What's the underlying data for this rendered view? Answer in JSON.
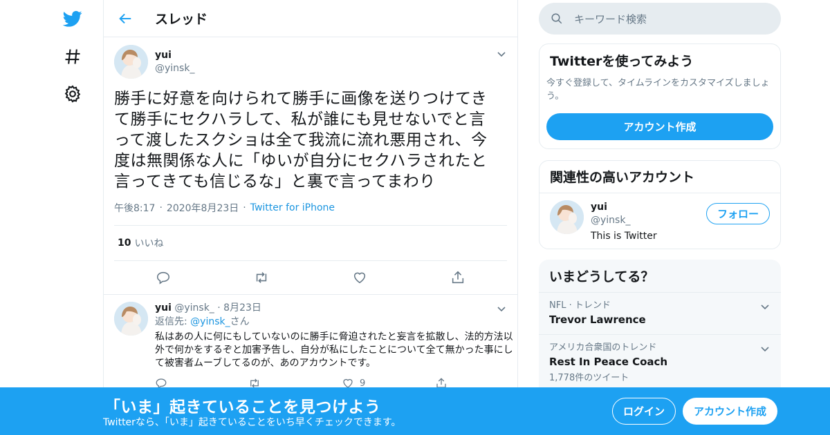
{
  "colors": {
    "accent": "#1da1f2",
    "muted": "#657786",
    "border": "#e6ecf0"
  },
  "nav": {
    "icons": [
      "twitter-logo-icon",
      "hashtag-icon",
      "gear-icon"
    ]
  },
  "header": {
    "title": "スレッド"
  },
  "tweet": {
    "name": "yui",
    "handle": "@yinsk_",
    "text": "勝手に好意を向けられて勝手に画像を送りつけてきて勝手にセクハラして、私が誰にも見せないでと言って渡したスクショは全て我流に流れ悪用され、今度は無関係な人に「ゆいが自分にセクハラされたと言ってきても信じるな」と裏で言ってまわり",
    "time": "午後8:17",
    "date": "2020年8月23日",
    "source": "Twitter for iPhone",
    "likes_count": "10",
    "likes_label": "いいね"
  },
  "reply": {
    "name": "yui",
    "handle": "@yinsk_",
    "date": "8月23日",
    "reply_to_prefix": "返信先: ",
    "reply_to_user": "@yinsk_",
    "reply_to_suffix": "さん",
    "text": "私はあの人に何にもしていないのに勝手に脅迫されたと妄言を拡散し、法的方法以外で何かをするぞと加害予告し、自分が私にしたことについて全て無かった事にして被害者ムーブしてるのが、あのアカウントです。",
    "like_count": "9"
  },
  "search": {
    "placeholder": "キーワード検索"
  },
  "signup_card": {
    "title": "Twitterを使ってみよう",
    "desc": "今すぐ登録して、タイムラインをカスタマイズしましょう。",
    "button": "アカウント作成"
  },
  "related": {
    "title": "関連性の高いアカウント",
    "name": "yui",
    "handle": "@yinsk_",
    "bio": "This is Twitter",
    "follow": "フォロー"
  },
  "trends": {
    "title": "いまどうしてる？",
    "items": [
      {
        "category": "NFL · トレンド",
        "name": "Trevor Lawrence"
      },
      {
        "category": "アメリカ合衆国のトレンド",
        "name": "Rest In Peace Coach",
        "count": "1,778件のツイート"
      }
    ]
  },
  "bottom_bar": {
    "title": "「いま」起きていることを見つけよう",
    "subtitle": "Twitterなら、「いま」起きていることをいち早くチェックできます。",
    "login": "ログイン",
    "signup": "アカウント作成"
  }
}
